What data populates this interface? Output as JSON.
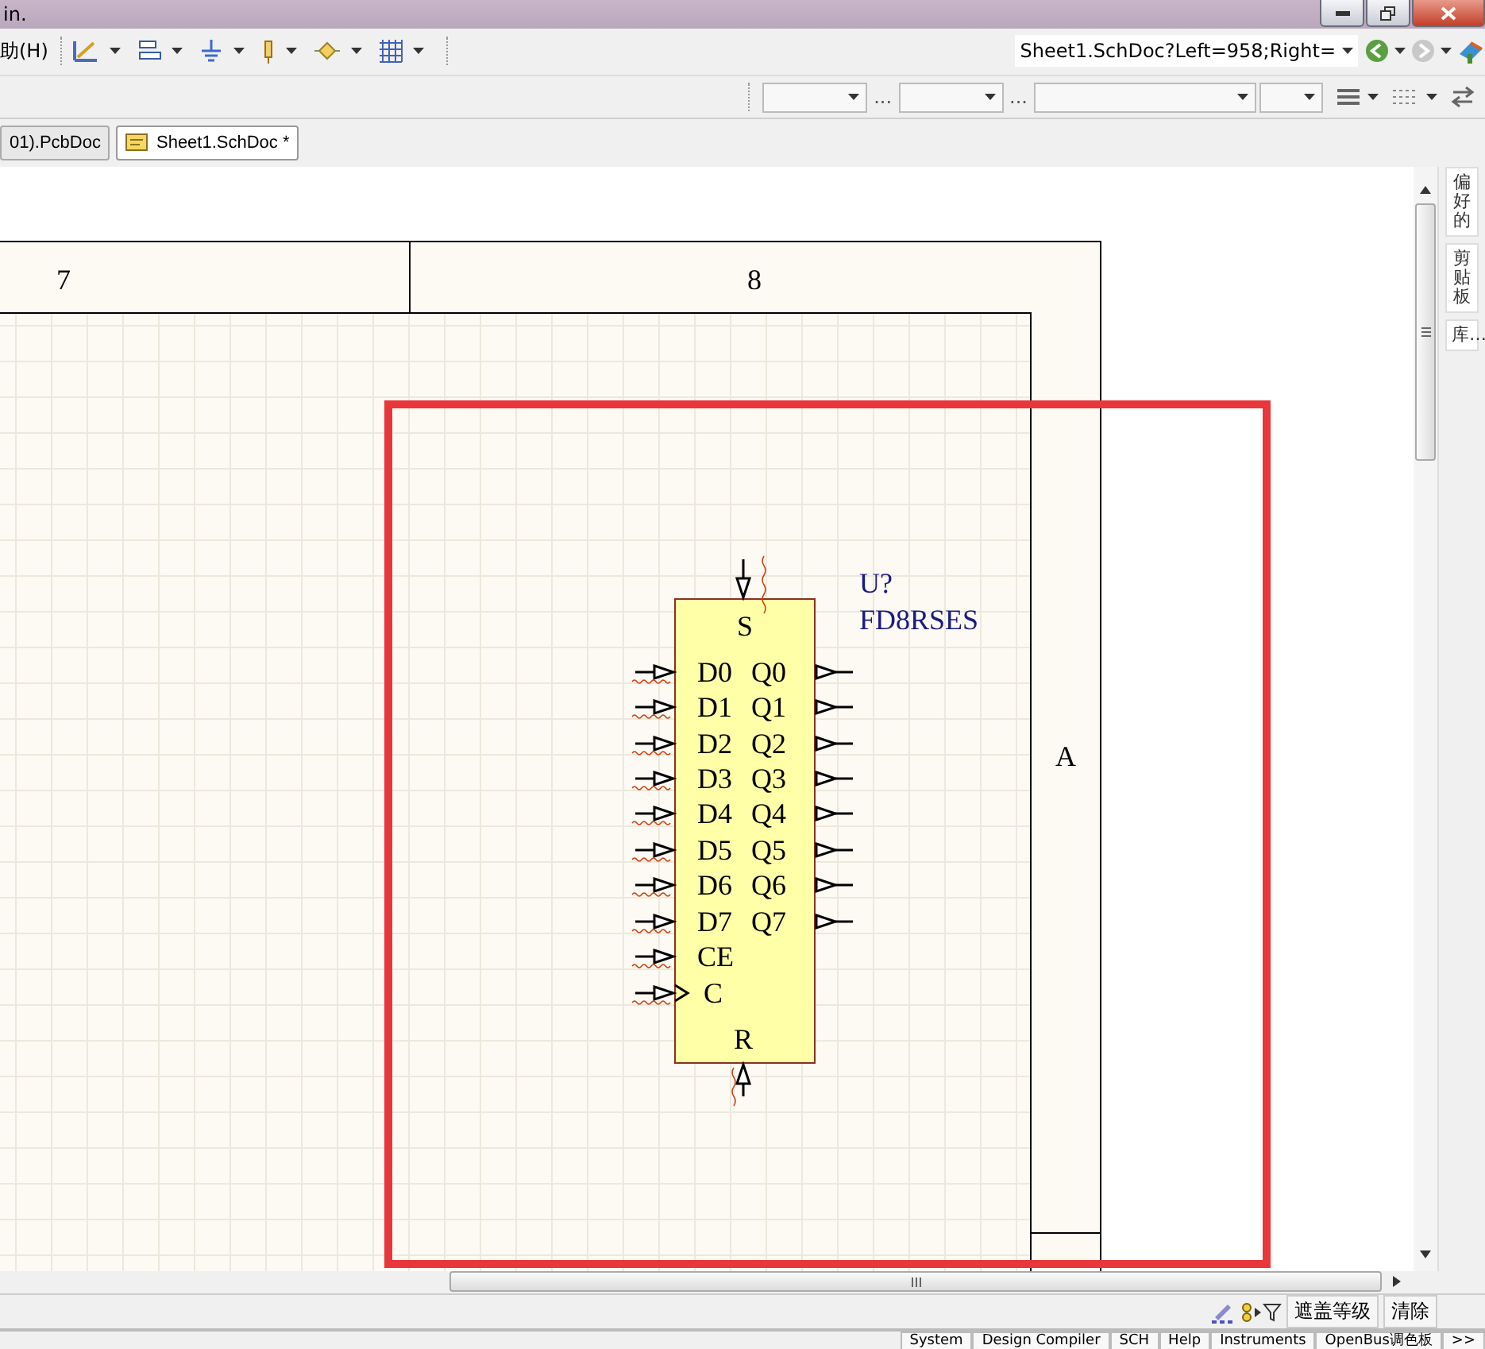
{
  "title_bar": {
    "title": "in."
  },
  "menu": {
    "items": [
      {
        "label": "助(H)"
      }
    ]
  },
  "toolbar": {
    "navigation": "Sheet1.SchDoc?Left=958;Right="
  },
  "filter_bar": {
    "separators": [
      "...",
      "..."
    ]
  },
  "document_tabs": [
    {
      "label": "01).PcbDoc",
      "selected": false
    },
    {
      "label": "Sheet1.SchDoc *",
      "selected": true
    }
  ],
  "schematic": {
    "columns": [
      "7",
      "8"
    ],
    "row_label": "A",
    "component": {
      "designator": "U?",
      "part": "FD8RSES",
      "top_pin": "S",
      "bottom_pin": "R",
      "left_pins": [
        {
          "label": "D0",
          "kind": "input"
        },
        {
          "label": "D1",
          "kind": "input"
        },
        {
          "label": "D2",
          "kind": "input"
        },
        {
          "label": "D3",
          "kind": "input"
        },
        {
          "label": "D4",
          "kind": "input"
        },
        {
          "label": "D5",
          "kind": "input"
        },
        {
          "label": "D6",
          "kind": "input"
        },
        {
          "label": "D7",
          "kind": "input"
        },
        {
          "label": "CE",
          "kind": "input"
        },
        {
          "label": "C",
          "kind": "clock"
        }
      ],
      "right_pins": [
        {
          "label": "Q0"
        },
        {
          "label": "Q1"
        },
        {
          "label": "Q2"
        },
        {
          "label": "Q3"
        },
        {
          "label": "Q4"
        },
        {
          "label": "Q5"
        },
        {
          "label": "Q6"
        },
        {
          "label": "Q7"
        }
      ]
    }
  },
  "side_panels": [
    {
      "label": "偏好的"
    },
    {
      "label": "剪贴板"
    },
    {
      "label": "库…"
    }
  ],
  "status_bar": {
    "buttons": [
      {
        "label": "遮盖等级"
      },
      {
        "label": "清除"
      }
    ]
  },
  "panel_tabs": [
    {
      "label": "System"
    },
    {
      "label": "Design Compiler"
    },
    {
      "label": "SCH"
    },
    {
      "label": "Help"
    },
    {
      "label": "Instruments"
    },
    {
      "label": "OpenBus调色板"
    },
    {
      "label": ">>"
    }
  ]
}
